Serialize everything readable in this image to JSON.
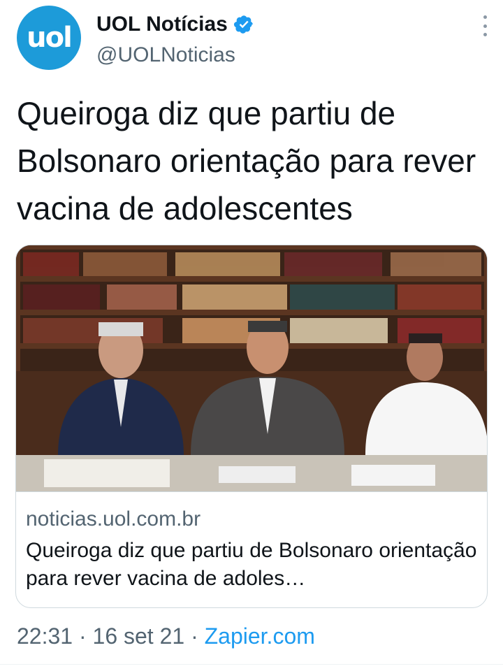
{
  "tweet": {
    "avatar_text": "uol",
    "display_name": "UOL Notícias",
    "handle": "@UOLNoticias",
    "text": "Queiroga diz que partiu de Bolsonaro orientação para rever vacina de adolescentes",
    "card": {
      "domain": "noticias.uol.com.br",
      "title": "Queiroga diz que partiu de Bolsonaro orientação para rever vacina de adoles…"
    },
    "time": "22:31",
    "date": "16 set 21",
    "source": "Zapier.com",
    "separator": "·"
  },
  "colors": {
    "avatar": "#1d9bd9",
    "verified": "#1d9bf0",
    "link": "#1d9bf0",
    "secondary_text": "#536471"
  }
}
